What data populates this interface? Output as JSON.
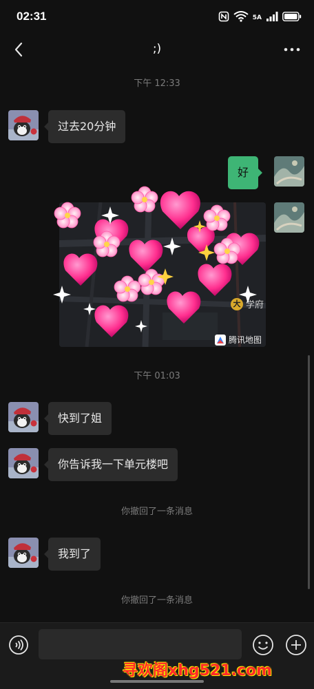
{
  "status_bar": {
    "time": "02:31",
    "network_label": "5A"
  },
  "header": {
    "title": ";)"
  },
  "messages": {
    "time1": "下午 12:33",
    "msg1": "过去20分钟",
    "msg2": "好",
    "map": {
      "poi_glyph": "大",
      "poi_label": "学府",
      "brand": "腾讯地图"
    },
    "time2": "下午 01:03",
    "msg3": "快到了姐",
    "msg4": "你告诉我一下单元楼吧",
    "recall1": "你撤回了一条消息",
    "msg5": "我到了",
    "recall2": "你撤回了一条消息"
  },
  "watermark": "寻欢阁xhg521.com",
  "colors": {
    "background": "#111111",
    "bubble_incoming": "#2c2c2c",
    "bubble_outgoing": "#3eb575",
    "watermark": "#ff2a2a"
  },
  "icons": [
    "back-icon",
    "more-icon",
    "voice-icon",
    "emoji-icon",
    "plus-icon"
  ]
}
